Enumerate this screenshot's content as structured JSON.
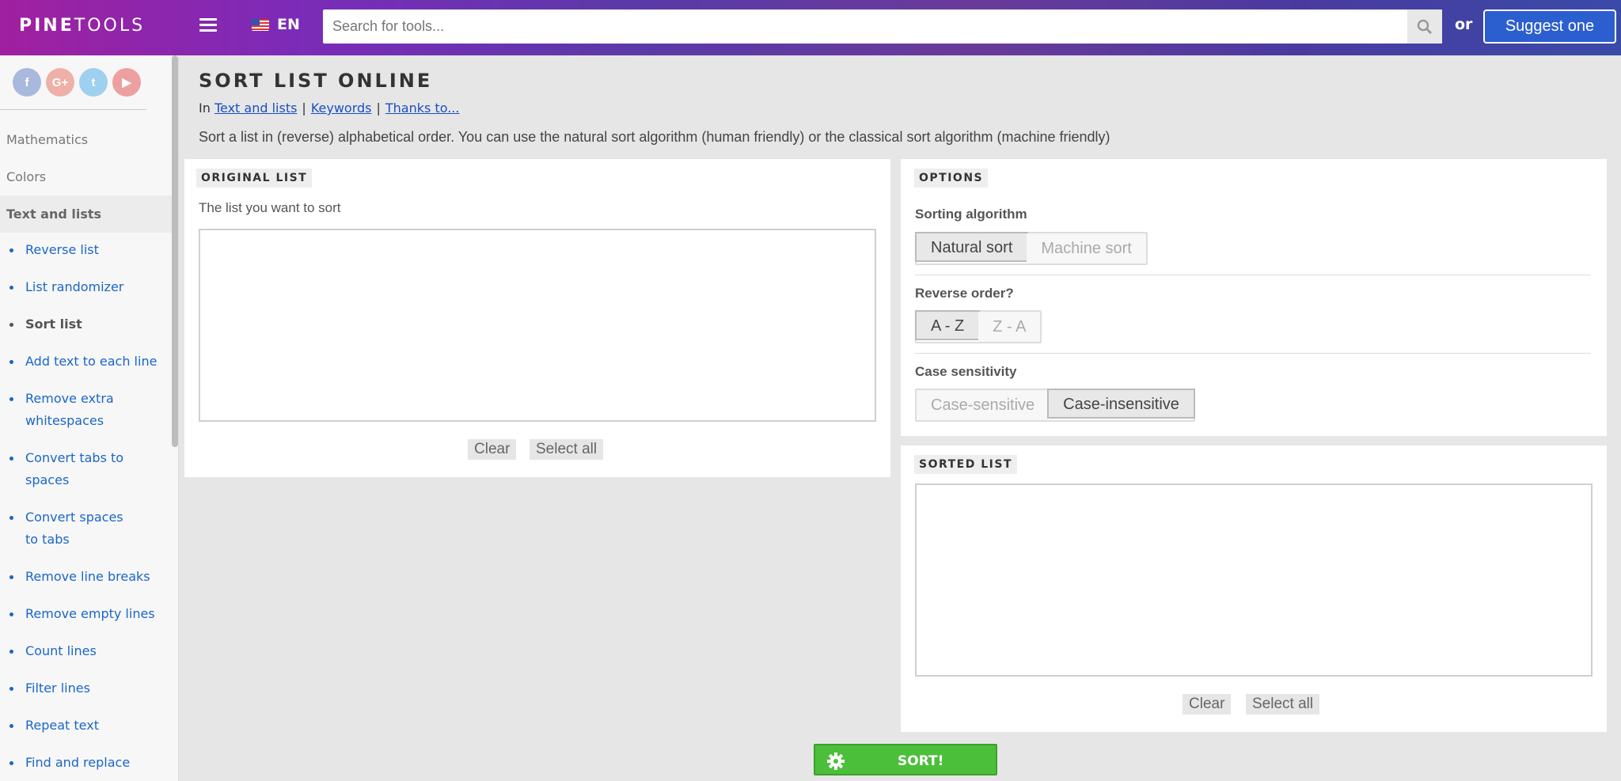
{
  "header": {
    "logo_bold": "PINE",
    "logo_thin": "TOOLS",
    "language": "EN",
    "search_placeholder": "Search for tools...",
    "or_text": "or",
    "suggest_label": "Suggest one"
  },
  "sidebar": {
    "social": [
      "f",
      "G+",
      "t",
      "▶"
    ],
    "categories": [
      "Mathematics",
      "Colors",
      "Text and lists"
    ],
    "items": [
      "Reverse list",
      "List randomizer",
      "Sort list",
      "Add text to each line",
      "Remove extra whitespaces",
      "Convert tabs to spaces",
      "Convert spaces to tabs",
      "Remove line breaks",
      "Remove empty lines",
      "Count lines",
      "Filter lines",
      "Repeat text",
      "Find and replace"
    ]
  },
  "page": {
    "title": "SORT LIST ONLINE",
    "crumb_prefix": "In",
    "crumb_category": "Text and lists",
    "crumb_keywords": "Keywords",
    "crumb_thanks": "Thanks to...",
    "description": "Sort a list in (reverse) alphabetical order. You can use the natural sort algorithm (human friendly) or the classical sort algorithm (machine friendly)"
  },
  "original": {
    "badge": "ORIGINAL LIST",
    "label": "The list you want to sort",
    "value": "",
    "clear": "Clear",
    "select_all": "Select all"
  },
  "options": {
    "badge": "OPTIONS",
    "algorithm_label": "Sorting algorithm",
    "algorithm_options": [
      "Natural sort",
      "Machine sort"
    ],
    "algorithm_selected": "Natural sort",
    "reverse_label": "Reverse order?",
    "reverse_options": [
      "A - Z",
      "Z - A"
    ],
    "reverse_selected": "A - Z",
    "case_label": "Case sensitivity",
    "case_options": [
      "Case-sensitive",
      "Case-insensitive"
    ],
    "case_selected": "Case-insensitive"
  },
  "sorted": {
    "badge": "SORTED LIST",
    "value": "",
    "clear": "Clear",
    "select_all": "Select all"
  },
  "sort_button": "SORT!",
  "colors": {
    "link": "#1a66c8",
    "sort_green": "#4cbf3a",
    "suggest_blue": "#2b5fd0"
  }
}
